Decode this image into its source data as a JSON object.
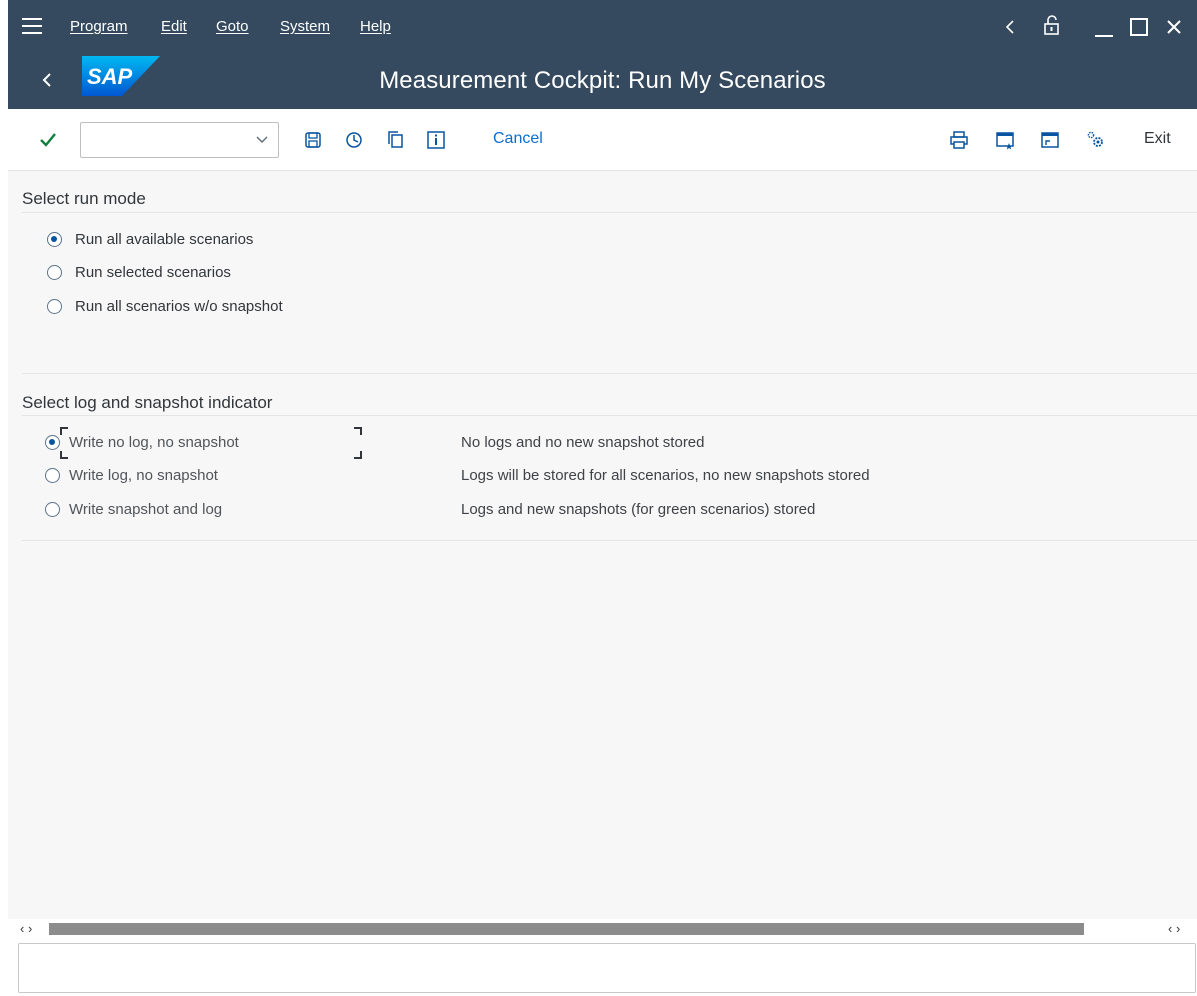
{
  "menu": {
    "items": [
      "Program",
      "Edit",
      "Goto",
      "System",
      "Help"
    ]
  },
  "title": "Measurement Cockpit: Run My Scenarios",
  "logo_text": "SAP",
  "toolbar": {
    "command_value": "",
    "cancel_label": "Cancel",
    "exit_label": "Exit"
  },
  "section_run_mode": {
    "title": "Select run mode",
    "options": [
      {
        "label": "Run all available scenarios",
        "selected": true
      },
      {
        "label": "Run selected scenarios",
        "selected": false
      },
      {
        "label": "Run all scenarios w/o snapshot",
        "selected": false
      }
    ]
  },
  "section_log": {
    "title": "Select log and snapshot indicator",
    "options": [
      {
        "label": "Write no log, no snapshot",
        "desc": "No logs and no new snapshot stored",
        "selected": true
      },
      {
        "label": "Write log, no snapshot",
        "desc": "Logs will be stored for all scenarios, no new snapshots stored",
        "selected": false
      },
      {
        "label": "Write snapshot and log",
        "desc": "Logs and new snapshots (for green scenarios) stored",
        "selected": false
      }
    ]
  },
  "status_text": "",
  "colors": {
    "shell": "#354a5f",
    "accent": "#0a6ed1",
    "confirm": "#107e3e"
  }
}
